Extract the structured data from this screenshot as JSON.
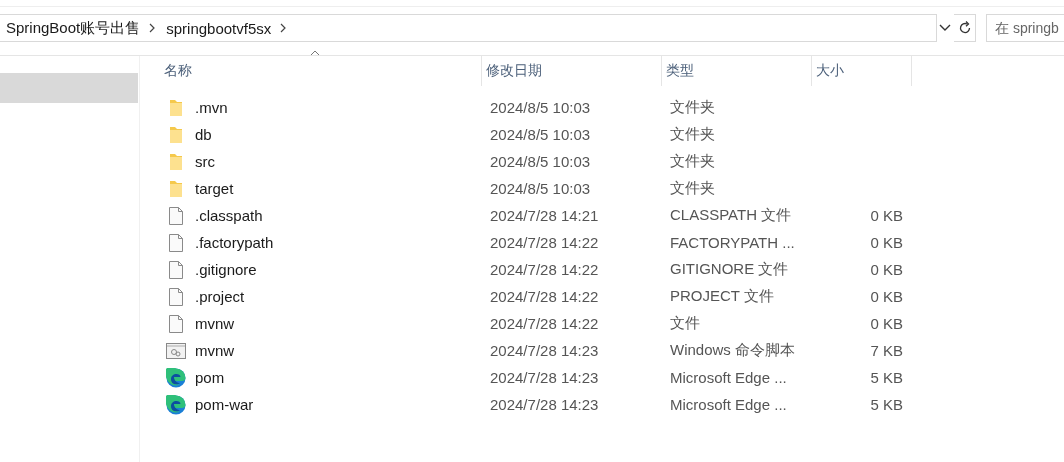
{
  "address_bar": {
    "breadcrumbs": [
      "SpringBoot账号出售",
      "springbootvf5sx"
    ]
  },
  "search": {
    "placeholder": "在 springb"
  },
  "sidebar": {
    "items": [
      {
        "selected": true
      }
    ]
  },
  "table": {
    "columns": [
      {
        "label": "名称",
        "sorted": true
      },
      {
        "label": "修改日期",
        "sorted": false
      },
      {
        "label": "类型",
        "sorted": false
      },
      {
        "label": "大小",
        "sorted": false
      }
    ],
    "rows": [
      {
        "kind": "folder",
        "name": ".mvn",
        "date": "2024/8/5 10:03",
        "type": "文件夹"
      },
      {
        "kind": "folder",
        "name": "db",
        "date": "2024/8/5 10:03",
        "type": "文件夹"
      },
      {
        "kind": "folder",
        "name": "src",
        "date": "2024/8/5 10:03",
        "type": "文件夹"
      },
      {
        "kind": "folder",
        "name": "target",
        "date": "2024/8/5 10:03",
        "type": "文件夹"
      },
      {
        "kind": "file",
        "name": ".classpath",
        "date": "2024/7/28 14:21",
        "type": "CLASSPATH 文件",
        "size": "0 KB"
      },
      {
        "kind": "file",
        "name": ".factorypath",
        "date": "2024/7/28 14:22",
        "type": "FACTORYPATH ...",
        "size": "0 KB"
      },
      {
        "kind": "file",
        "name": ".gitignore",
        "date": "2024/7/28 14:22",
        "type": "GITIGNORE 文件",
        "size": "0 KB"
      },
      {
        "kind": "file",
        "name": ".project",
        "date": "2024/7/28 14:22",
        "type": "PROJECT 文件",
        "size": "0 KB"
      },
      {
        "kind": "file",
        "name": "mvnw",
        "date": "2024/7/28 14:22",
        "type": "文件",
        "size": "0 KB"
      },
      {
        "kind": "script",
        "name": "mvnw",
        "date": "2024/7/28 14:23",
        "type": "Windows 命令脚本",
        "size": "7 KB"
      },
      {
        "kind": "edge",
        "name": "pom",
        "date": "2024/7/28 14:23",
        "type": "Microsoft Edge ...",
        "size": "5 KB"
      },
      {
        "kind": "edge",
        "name": "pom-war",
        "date": "2024/7/28 14:23",
        "type": "Microsoft Edge ...",
        "size": "5 KB"
      }
    ]
  }
}
